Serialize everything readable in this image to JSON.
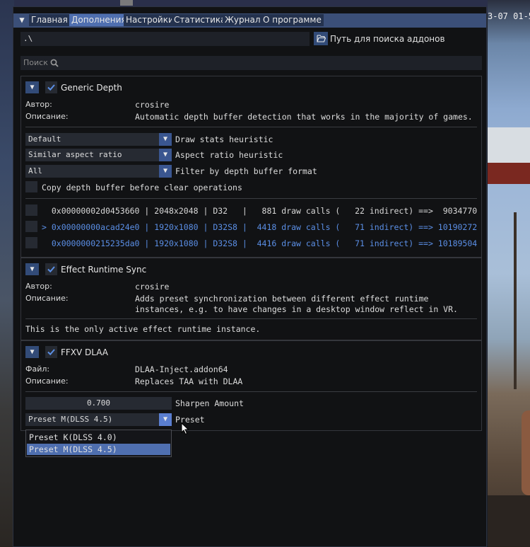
{
  "clock": "3-07 01-5",
  "menu": {
    "toggle_icon": "menu-triangle-icon",
    "tabs": [
      {
        "label": "Главная",
        "active": false
      },
      {
        "label": "Дополнения",
        "active": true
      },
      {
        "label": "Настройки",
        "active": false
      },
      {
        "label": "Статистика",
        "active": false
      },
      {
        "label": "Журнал",
        "active": false
      },
      {
        "label": "О программе",
        "active": false
      }
    ]
  },
  "addon_path": {
    "value": ".\\",
    "button_icon": "folder-open-icon",
    "label": "Путь для поиска аддонов"
  },
  "search": {
    "placeholder": "Поиск",
    "icon": "search-icon"
  },
  "addons": {
    "generic_depth": {
      "title": "Generic Depth",
      "enabled": true,
      "author_label": "Автор:",
      "author": "crosire",
      "desc_label": "Описание:",
      "description": "Automatic depth buffer detection that works in the majority of games.",
      "settings": [
        {
          "value": "Default",
          "label": "Draw stats heuristic"
        },
        {
          "value": "Similar aspect ratio",
          "label": "Aspect ratio heuristic"
        },
        {
          "value": "All",
          "label": "Filter by depth buffer format"
        }
      ],
      "copy_label": "Copy depth buffer before clear operations",
      "buffers": [
        {
          "text": "  0x00000002d0453660 | 2048x2048 | D32   |   881 draw calls (   22 indirect) ==>  9034770",
          "selected": false
        },
        {
          "text": "> 0x00000000acad24e0 | 1920x1080 | D32S8 |  4418 draw calls (   71 indirect) ==> 10190272",
          "selected": true
        },
        {
          "text": "  0x0000000215235da0 | 1920x1080 | D32S8 |  4416 draw calls (   71 indirect) ==> 10189504",
          "selected": false
        }
      ]
    },
    "effect_runtime_sync": {
      "title": "Effect Runtime Sync",
      "enabled": true,
      "author_label": "Автор:",
      "author": "crosire",
      "desc_label": "Описание:",
      "description_1": "Adds preset synchronization between different effect runtime",
      "description_2": "instances, e.g. to have changes in a desktop window reflect in VR.",
      "note": "This is the only active effect runtime instance."
    },
    "ffxv_dlaa": {
      "title": "FFXV DLAA",
      "enabled": true,
      "file_label": "Файл:",
      "file": "DLAA-Inject.addon64",
      "desc_label": "Описание:",
      "description": "Replaces TAA with DLAA",
      "sharpen_value": "0.700",
      "sharpen_label": "Sharpen Amount",
      "preset_value": "Preset M(DLSS 4.5)",
      "preset_label": "Preset",
      "preset_options": [
        "Preset K(DLSS 4.0)",
        "Preset M(DLSS 4.5)"
      ],
      "preset_selected_index": 1
    }
  }
}
